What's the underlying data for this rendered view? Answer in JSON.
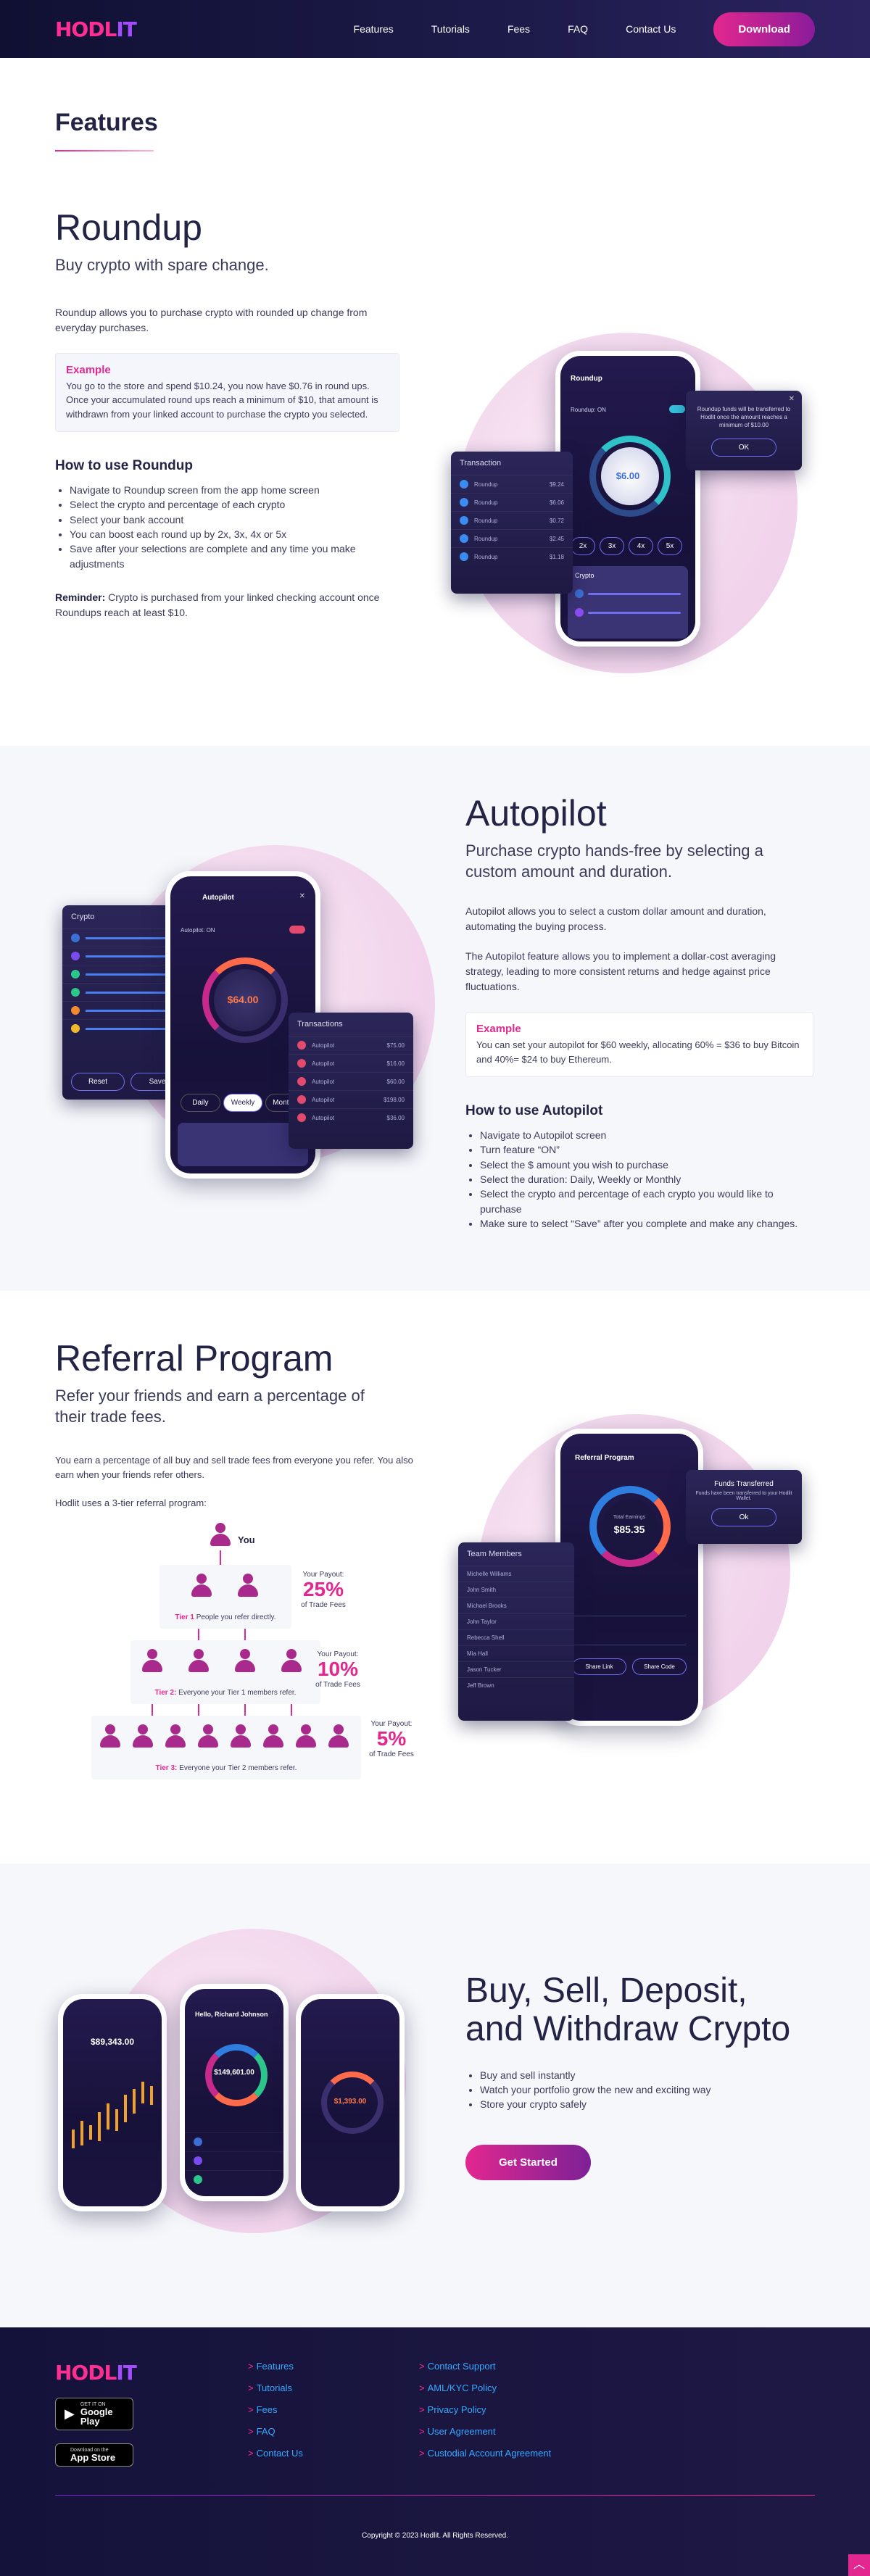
{
  "header": {
    "logo_hodl": "HODL",
    "logo_it": "IT",
    "nav": [
      "Features",
      "Tutorials",
      "Fees",
      "FAQ",
      "Contact Us"
    ],
    "download_label": "Download"
  },
  "features_title": "Features",
  "roundup": {
    "title": "Roundup",
    "subtitle": "Buy crypto with spare change.",
    "intro": "Roundup allows you to purchase crypto with rounded up change from everyday purchases.",
    "example_title": "Example",
    "example_body": "You go to the store and spend $10.24, you now have $0.76 in round ups. Once your accumulated round ups reach a minimum of $10, that amount is withdrawn from your linked account to purchase the crypto you selected.",
    "how_title": "How to use Roundup",
    "steps": [
      "Navigate to Roundup screen from the app home screen",
      "Select the crypto and percentage of each crypto",
      "Select your bank account",
      "You can boost each round up by 2x, 3x, 4x or 5x",
      "Save after your selections are complete and any time you make adjustments"
    ],
    "reminder_label": "Reminder:",
    "reminder_text": "Crypto is purchased from your linked checking account once Roundups reach at least $10.",
    "ui": {
      "phone_title": "Roundup",
      "toggle_label": "Roundup: ON",
      "amount": "$6.00",
      "modal_text": "Roundup funds will be transferred to Hodlit once the amount reaches a minimum of $10.00",
      "modal_ok": "OK",
      "tx_title": "Transaction",
      "tx_rows": [
        "Roundup",
        "Roundup",
        "Roundup",
        "Roundup",
        "Roundup"
      ],
      "tx_amounts": [
        "$9.24",
        "$6.06",
        "$0.72",
        "$2.45",
        "$1.18"
      ],
      "boost": [
        "2x",
        "3x",
        "4x",
        "5x"
      ],
      "crypto_label": "Crypto"
    }
  },
  "autopilot": {
    "title": "Autopilot",
    "subtitle": "Purchase crypto hands-free by selecting a custom amount and duration.",
    "p1": "Autopilot allows you to select a custom dollar amount and duration, automating the buying process.",
    "p2": "The Autopilot  feature allows you to implement a dollar-cost averaging strategy, leading to more consistent returns and hedge against price fluctuations.",
    "example_title": "Example",
    "example_body": "You can set your autopilot for $60 weekly, allocating 60% = $36 to buy Bitcoin and 40%= $24 to buy Ethereum.",
    "how_title": "How to use Autopilot",
    "steps": [
      "Navigate to Autopilot screen",
      "Turn feature “ON”",
      "Select the $ amount you wish to purchase",
      "Select the duration: Daily, Weekly or Monthly",
      "Select the crypto and percentage of each crypto you would like to purchase",
      "Make sure to select “Save” after you complete and make any changes."
    ],
    "ui": {
      "phone_title": "Autopilot",
      "toggle_label": "Autopilot: ON",
      "amount": "$64.00",
      "duration_options": [
        "Daily",
        "Weekly",
        "Monthly"
      ],
      "crypto_title": "Crypto",
      "reset": "Reset",
      "save": "Save",
      "tx_title": "Transactions",
      "tx_rows": [
        "Autopilot",
        "Autopilot",
        "Autopilot",
        "Autopilot",
        "Autopilot"
      ],
      "tx_amounts": [
        "$75.00",
        "$16.00",
        "$60.00",
        "$198.00",
        "$36.00"
      ]
    }
  },
  "referral": {
    "title": "Referral Program",
    "subtitle": "Refer your friends and earn a percentage of their trade fees.",
    "p1": "You earn a percentage of all buy and sell trade fees from everyone you refer. You also earn when your friends refer others.",
    "p2": "Hodlit uses a 3-tier referral program:",
    "you_label": "You",
    "tiers": [
      {
        "name": "Tier 1",
        "desc": "People you refer directly.",
        "payout_label": "Your Payout:",
        "pct": "25%",
        "suffix": "of Trade Fees"
      },
      {
        "name": "Tier 2:",
        "desc": "Everyone your Tier 1 members refer.",
        "payout_label": "Your Payout:",
        "pct": "10%",
        "suffix": "of Trade Fees"
      },
      {
        "name": "Tier 3:",
        "desc": "Everyone your Tier 2 members refer.",
        "payout_label": "Your Payout:",
        "pct": "5%",
        "suffix": "of Trade Fees"
      }
    ],
    "ui": {
      "phone_title": "Referral Program",
      "amount_label": "Total Earnings",
      "amount": "$85.35",
      "share_link": "Share Link",
      "share_code": "Share Code",
      "modal_title": "Funds Transferred",
      "modal_text": "Funds have been transferred to your Hodlit Wallet.",
      "modal_ok": "Ok",
      "team_title": "Team Members",
      "members": [
        "Michelle Williams",
        "John Smith",
        "Michael Brooks",
        "John Taylor",
        "Rebecca Shell",
        "Mia Hall",
        "Jason Tucker",
        "Jeff Brown"
      ]
    }
  },
  "bsdw": {
    "title": "Buy, Sell, Deposit, and Withdraw Crypto",
    "bullets": [
      "Buy and sell instantly",
      "Watch your portfolio grow the new and exciting way",
      "Store your crypto safely"
    ],
    "cta": "Get Started",
    "ui": {
      "phone1_amount": "$89,343.00",
      "phone2_name": "Hello, Richard Johnson",
      "phone2_amount": "$149,601.00",
      "phone3_amount": "$1,393.00"
    }
  },
  "footer": {
    "logo_hodl": "HODL",
    "logo_it": "IT",
    "google_small": "GET IT ON",
    "google_big": "Google Play",
    "apple_small": "Download on the",
    "apple_big": "App Store",
    "col1": [
      "Features",
      "Tutorials",
      "Fees",
      "FAQ",
      "Contact Us"
    ],
    "col2": [
      "Contact Support",
      "AML/KYC Policy",
      "Privacy Policy",
      "User Agreement",
      "Custodial Account Agreement"
    ],
    "copyright": "Copyright © 2023 Hodlit. All Rights Reserved."
  }
}
